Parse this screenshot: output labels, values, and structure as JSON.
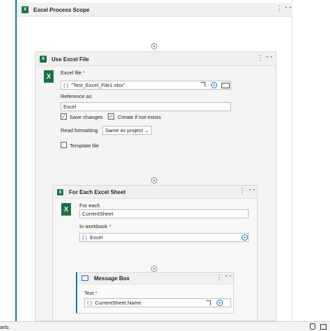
{
  "scope": {
    "title": "Excel Process Scope"
  },
  "use_excel_file": {
    "title": "Use Excel File",
    "excel_file_label": "Excel file",
    "required_mark": "*",
    "excel_file_value": "\"Test_Excel_File1.xlsx\"",
    "reference_label": "Reference as",
    "reference_value": "Excel",
    "save_changes_label": "Save changes",
    "save_changes_checked": true,
    "create_if_not_exists_label": "Create if not exists",
    "create_if_not_exists_checked": true,
    "read_formatting_label": "Read formatting",
    "read_formatting_value": "Same as project",
    "template_file_label": "Template file",
    "template_file_checked": false
  },
  "for_each_sheet": {
    "title": "For Each Excel Sheet",
    "for_each_label": "For each",
    "for_each_value": "CurrentSheet",
    "in_workbook_label": "In workbook",
    "required_mark": "*",
    "in_workbook_value": "Excel"
  },
  "message_box": {
    "title": "Message Box",
    "text_label": "Text",
    "required_mark": "*",
    "text_value": "CurrentSheet.Name"
  },
  "common": {
    "braces": "{ }",
    "plus": "+",
    "kebab": "⋮",
    "collapse": "⌃⌃",
    "excel_letter": "X"
  },
  "status_bar": {
    "left_text": "arts"
  }
}
